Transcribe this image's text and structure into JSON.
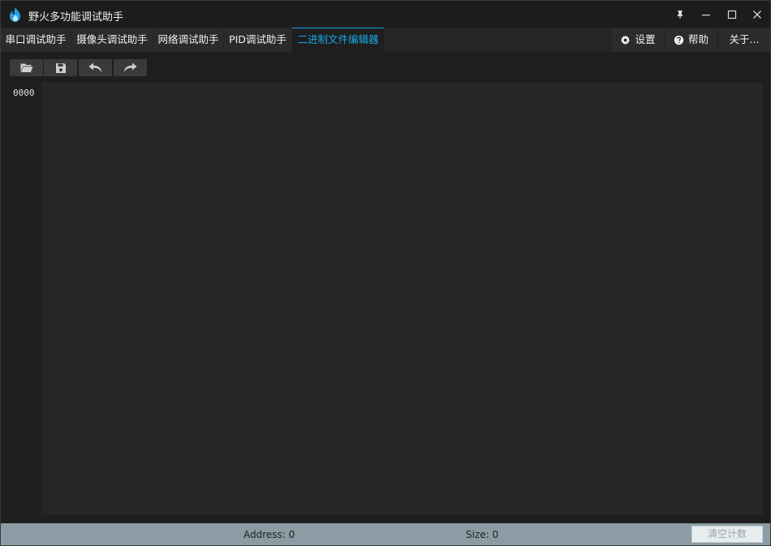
{
  "app": {
    "title": "野火多功能调试助手"
  },
  "window_controls": [
    "pin-icon",
    "minimize-icon",
    "maximize-icon",
    "close-icon"
  ],
  "tabs": [
    {
      "label": "串口调试助手",
      "active": false
    },
    {
      "label": "摄像头调试助手",
      "active": false
    },
    {
      "label": "网络调试助手",
      "active": false
    },
    {
      "label": "PID调试助手",
      "active": false
    },
    {
      "label": "二进制文件编辑器",
      "active": true
    }
  ],
  "right_menu": {
    "settings": {
      "label": "设置",
      "icon": "gear-icon"
    },
    "help": {
      "label": "帮助",
      "icon": "question-icon"
    },
    "about": {
      "label": "关于..."
    }
  },
  "toolbar": {
    "buttons": [
      "open-folder-icon",
      "save-icon",
      "undo-icon",
      "redo-icon"
    ]
  },
  "editor": {
    "line_numbers": [
      "0000"
    ]
  },
  "status": {
    "address": "Address: 0",
    "size": "Size: 0",
    "clear_label": "清空计数"
  },
  "colors": {
    "accent": "#1aa7e6",
    "background": "#1e1e1e",
    "editor_bg": "#262626",
    "statusbar_bg": "#8c9ca4"
  }
}
